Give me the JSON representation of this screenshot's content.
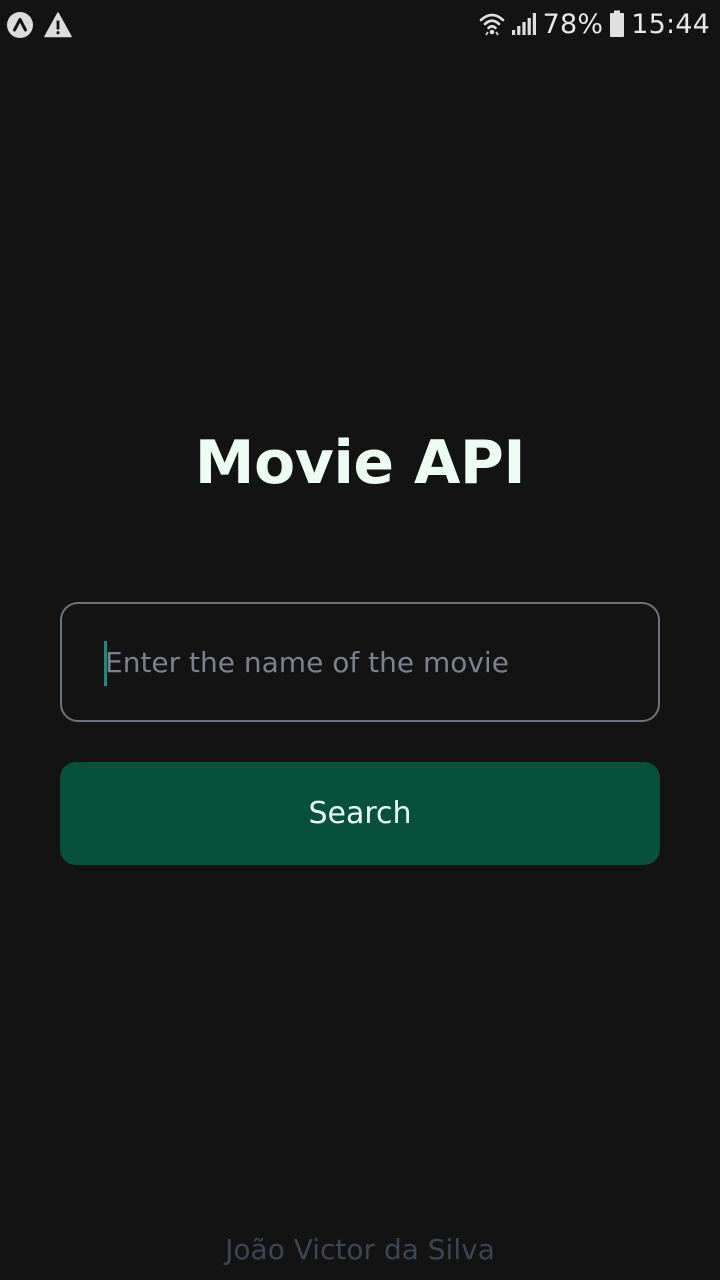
{
  "status_bar": {
    "left_icons": [
      "app-notification-icon",
      "warning-icon"
    ],
    "right_icons": [
      "wifi-icon",
      "signal-icon",
      "battery-icon"
    ],
    "battery_percent": "78%",
    "time": "15:44"
  },
  "main": {
    "title": "Movie API",
    "search": {
      "value": "",
      "placeholder": "Enter the name of the movie"
    },
    "search_button_label": "Search"
  },
  "footer": {
    "author": "João Victor da Silva"
  },
  "colors": {
    "background": "#131313",
    "title": "#ecfdf3",
    "button_bg": "#06503c",
    "input_border": "#6b7280",
    "caret": "#148f7e",
    "footer_text": "#3a4555"
  }
}
